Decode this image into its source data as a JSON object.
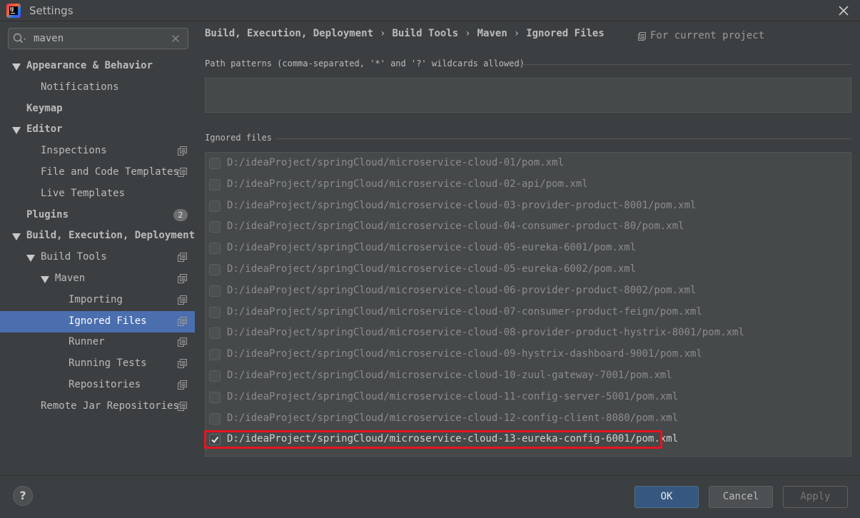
{
  "window": {
    "title": "Settings",
    "logo_text": "IJ"
  },
  "search": {
    "value": "maven"
  },
  "tree": [
    {
      "label": "Appearance & Behavior",
      "bold": true,
      "expanded": true,
      "indent": 0,
      "project_icon": false
    },
    {
      "label": "Notifications",
      "bold": false,
      "indent": 1,
      "project_icon": false
    },
    {
      "label": "Keymap",
      "bold": true,
      "indent": 0,
      "project_icon": false
    },
    {
      "label": "Editor",
      "bold": true,
      "expanded": true,
      "indent": 0,
      "project_icon": false
    },
    {
      "label": "Inspections",
      "bold": false,
      "indent": 1,
      "project_icon": true
    },
    {
      "label": "File and Code Templates",
      "bold": false,
      "indent": 1,
      "project_icon": true
    },
    {
      "label": "Live Templates",
      "bold": false,
      "indent": 1,
      "project_icon": false
    },
    {
      "label": "Plugins",
      "bold": true,
      "indent": 0,
      "project_icon": false,
      "badge": "2"
    },
    {
      "label": "Build, Execution, Deployment",
      "bold": true,
      "expanded": true,
      "indent": 0,
      "project_icon": false
    },
    {
      "label": "Build Tools",
      "bold": false,
      "expanded": true,
      "indent": 1,
      "project_icon": true
    },
    {
      "label": "Maven",
      "bold": false,
      "expanded": true,
      "indent": 2,
      "project_icon": true
    },
    {
      "label": "Importing",
      "bold": false,
      "indent": 3,
      "project_icon": true
    },
    {
      "label": "Ignored Files",
      "bold": false,
      "indent": 3,
      "project_icon": true,
      "selected": true
    },
    {
      "label": "Runner",
      "bold": false,
      "indent": 3,
      "project_icon": true
    },
    {
      "label": "Running Tests",
      "bold": false,
      "indent": 3,
      "project_icon": true
    },
    {
      "label": "Repositories",
      "bold": false,
      "indent": 3,
      "project_icon": true
    },
    {
      "label": "Remote Jar Repositories",
      "bold": false,
      "indent": 1,
      "project_icon": true
    }
  ],
  "breadcrumb": [
    "Build, Execution, Deployment",
    "Build Tools",
    "Maven",
    "Ignored Files"
  ],
  "breadcrumb_separator": "›",
  "scope_label": "For current project",
  "patterns": {
    "label": "Path patterns (comma-separated, '*' and '?' wildcards allowed)",
    "value": ""
  },
  "ignored": {
    "label": "Ignored files",
    "files": [
      {
        "path": "D:/ideaProject/springCloud/microservice-cloud-01/pom.xml",
        "checked": false
      },
      {
        "path": "D:/ideaProject/springCloud/microservice-cloud-02-api/pom.xml",
        "checked": false
      },
      {
        "path": "D:/ideaProject/springCloud/microservice-cloud-03-provider-product-8001/pom.xml",
        "checked": false
      },
      {
        "path": "D:/ideaProject/springCloud/microservice-cloud-04-consumer-product-80/pom.xml",
        "checked": false
      },
      {
        "path": "D:/ideaProject/springCloud/microservice-cloud-05-eureka-6001/pom.xml",
        "checked": false
      },
      {
        "path": "D:/ideaProject/springCloud/microservice-cloud-05-eureka-6002/pom.xml",
        "checked": false
      },
      {
        "path": "D:/ideaProject/springCloud/microservice-cloud-06-provider-product-8002/pom.xml",
        "checked": false
      },
      {
        "path": "D:/ideaProject/springCloud/microservice-cloud-07-consumer-product-feign/pom.xml",
        "checked": false
      },
      {
        "path": "D:/ideaProject/springCloud/microservice-cloud-08-provider-product-hystrix-8001/pom.xml",
        "checked": false
      },
      {
        "path": "D:/ideaProject/springCloud/microservice-cloud-09-hystrix-dashboard-9001/pom.xml",
        "checked": false
      },
      {
        "path": "D:/ideaProject/springCloud/microservice-cloud-10-zuul-gateway-7001/pom.xml",
        "checked": false
      },
      {
        "path": "D:/ideaProject/springCloud/microservice-cloud-11-config-server-5001/pom.xml",
        "checked": false
      },
      {
        "path": "D:/ideaProject/springCloud/microservice-cloud-12-config-client-8080/pom.xml",
        "checked": false
      },
      {
        "path": "D:/ideaProject/springCloud/microservice-cloud-13-eureka-config-6001/pom.xml",
        "checked": true
      }
    ]
  },
  "buttons": {
    "help": "?",
    "ok": "OK",
    "cancel": "Cancel",
    "apply": "Apply"
  },
  "colors": {
    "selection": "#4b6eaf",
    "highlight": "#e8141e",
    "ok_button": "#365880"
  }
}
